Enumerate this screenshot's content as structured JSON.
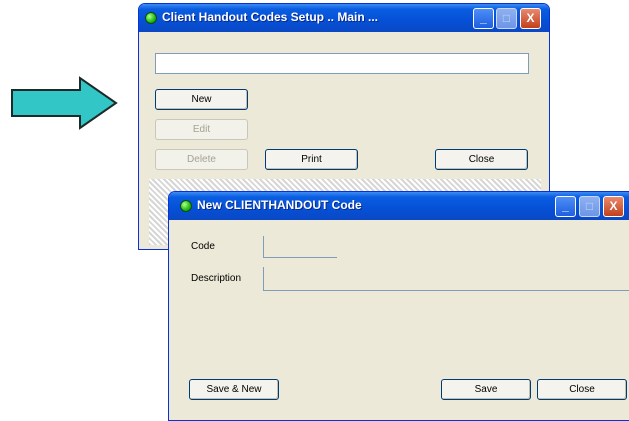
{
  "colors": {
    "arrow_fill": "#33c6c6",
    "arrow_stroke": "#1c2a2a",
    "xp_blue": "#0a5de1",
    "window_face": "#ece9d8"
  },
  "arrow": {
    "icon": "right-arrow-icon"
  },
  "main_window": {
    "title": "Client Handout Codes Setup .. Main ...",
    "icon": "app-status-icon",
    "title_buttons": {
      "minimize": "_",
      "maximize": "□",
      "close": "X"
    },
    "search_value": "",
    "buttons": {
      "new": "New",
      "edit": "Edit",
      "delete": "Delete",
      "print": "Print",
      "close": "Close"
    }
  },
  "dialog": {
    "title": "New CLIENTHANDOUT Code",
    "icon": "app-status-icon",
    "title_buttons": {
      "minimize": "_",
      "maximize": "□",
      "close": "X"
    },
    "fields": {
      "code_label": "Code",
      "code_value": "",
      "description_label": "Description",
      "description_value": ""
    },
    "buttons": {
      "save_and_new": "Save & New",
      "save": "Save",
      "close": "Close"
    }
  }
}
